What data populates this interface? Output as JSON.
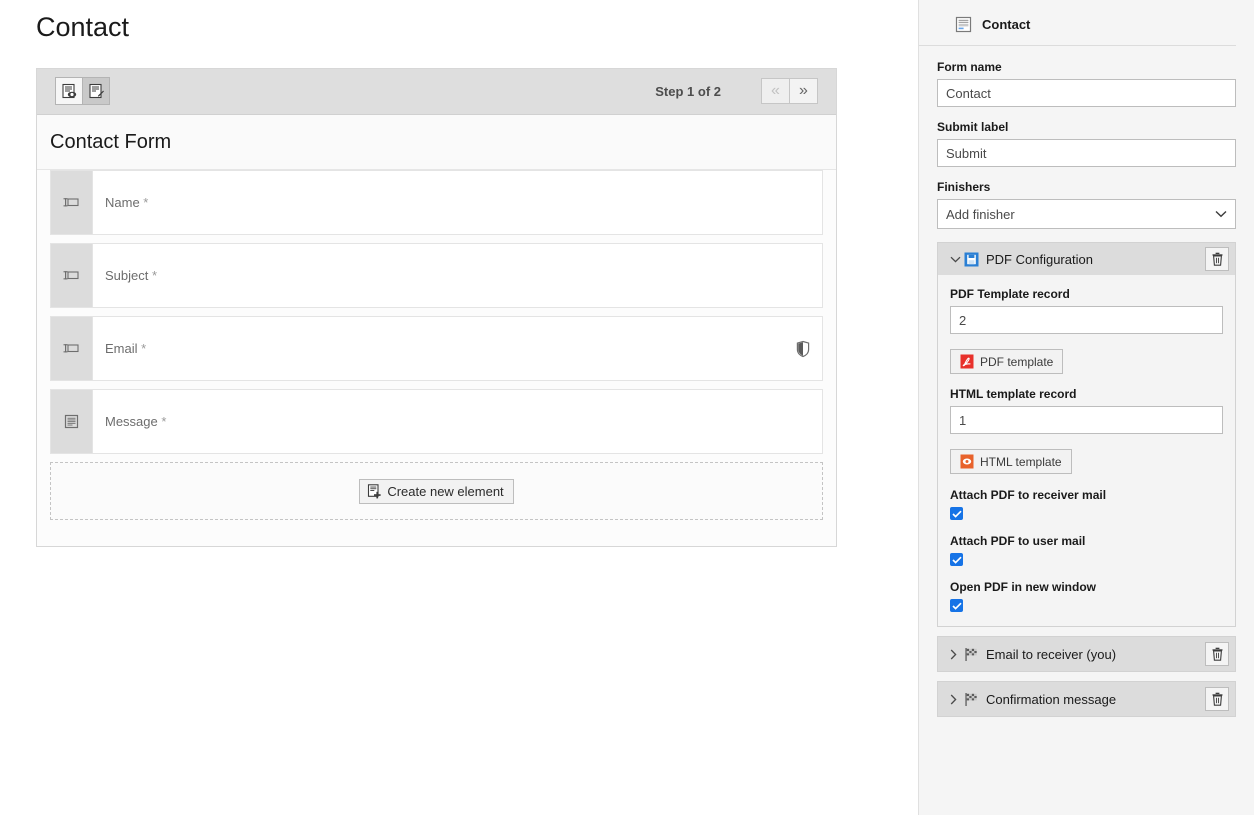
{
  "page": {
    "title": "Contact"
  },
  "editor": {
    "toolbar": {
      "preview_button": {
        "name": "preview-form-button",
        "icon": "form-preview-icon"
      },
      "edit_button": {
        "name": "edit-form-button",
        "icon": "form-edit-icon"
      }
    },
    "step_label": "Step 1 of 2",
    "prev_label": "«",
    "next_label": "»",
    "form_title": "Contact Form",
    "rows": [
      {
        "label": "Name",
        "required_mark": " *",
        "icon": "text-input-icon",
        "validator": ""
      },
      {
        "label": "Subject",
        "required_mark": " *",
        "icon": "text-input-icon",
        "validator": ""
      },
      {
        "label": "Email",
        "required_mark": " *",
        "icon": "text-input-icon",
        "validator": "shield-icon"
      },
      {
        "label": "Message",
        "required_mark": " *",
        "icon": "textarea-icon",
        "validator": ""
      }
    ],
    "create_element_label": "Create new element"
  },
  "inspector": {
    "header_title": "Contact",
    "form_name": {
      "label": "Form name",
      "value": "Contact",
      "placeholder": "Form name"
    },
    "submit_label": {
      "label": "Submit label",
      "value": "Submit",
      "placeholder": "Submit label"
    },
    "finishers": {
      "label": "Finishers",
      "selected": "Add finisher"
    },
    "pdf_config": {
      "title": "PDF Configuration",
      "expanded": true,
      "pdf_template_record": {
        "label": "PDF Template record",
        "value": "2"
      },
      "pdf_template_button": "PDF template",
      "html_template_record": {
        "label": "HTML template record",
        "value": "1"
      },
      "html_template_button": "HTML template",
      "checkboxes": [
        {
          "label": "Attach PDF to receiver mail",
          "checked": true
        },
        {
          "label": "Attach PDF to user mail",
          "checked": true
        },
        {
          "label": "Open PDF in new window",
          "checked": true
        }
      ]
    },
    "finisher_items": [
      {
        "title": "Email to receiver (you)",
        "expanded": false
      },
      {
        "title": "Confirmation message",
        "expanded": false
      }
    ]
  },
  "colors": {
    "accent_blue": "#1673e6",
    "pdf_red": "#e8312b",
    "html_orange": "#e8622b",
    "toolbar_gray": "#dedede",
    "panel_bg": "#f5f5f5"
  }
}
